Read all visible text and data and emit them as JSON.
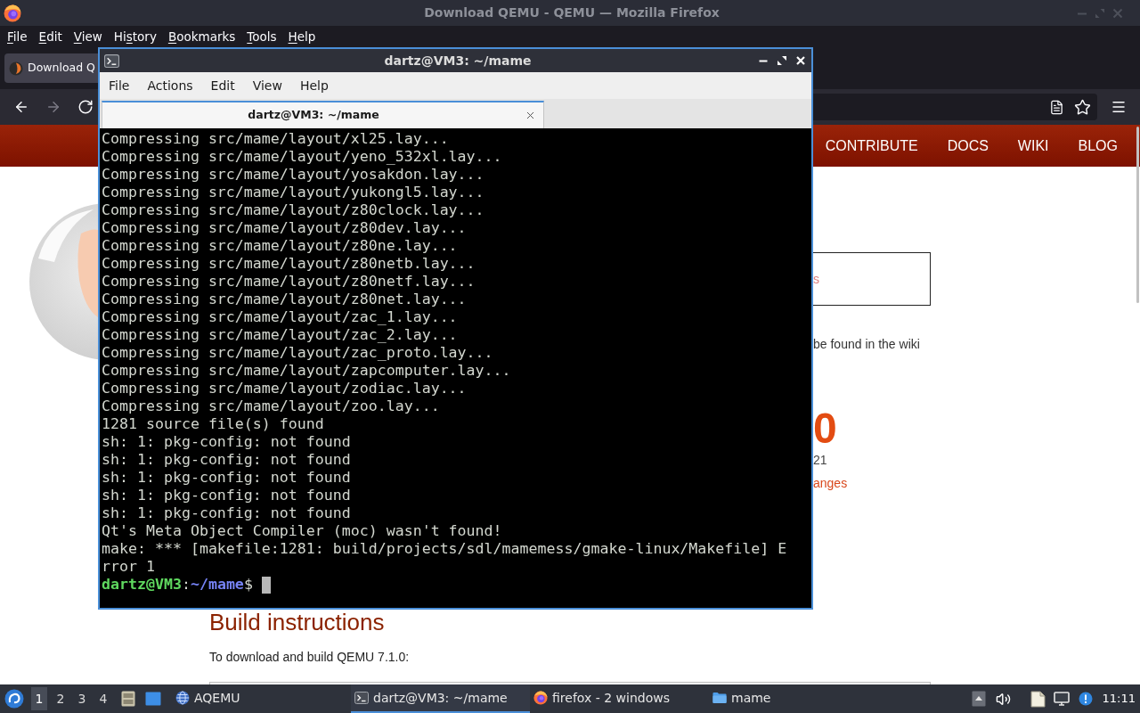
{
  "browser": {
    "title": "Download QEMU - QEMU — Mozilla Firefox",
    "menu": [
      {
        "key": "F",
        "post": "ile"
      },
      {
        "key": "E",
        "post": "dit"
      },
      {
        "key": "V",
        "post": "iew"
      },
      {
        "pre": "Hi",
        "key": "s",
        "post": "tory"
      },
      {
        "key": "B",
        "post": "ookmarks"
      },
      {
        "key": "T",
        "post": "ools"
      },
      {
        "key": "H",
        "post": "elp"
      }
    ],
    "tab": {
      "label": "Download Q",
      "selected": true
    },
    "nav_buttons": [
      {
        "kind": "back",
        "disabled": false
      },
      {
        "kind": "forward",
        "disabled": true
      },
      {
        "kind": "reload",
        "disabled": false
      }
    ],
    "page": {
      "nav_links": [
        "CONTRIBUTE",
        "DOCS",
        "WIKI",
        "BLOG"
      ],
      "notice_text": "s",
      "wiki_text": "be found in the wiki",
      "version": "0",
      "date": "21",
      "changes_link": "anges",
      "heading": "Build instructions",
      "intro": "To download and build QEMU 7.1.0:"
    }
  },
  "terminal": {
    "title": "dartz@VM3: ~/mame",
    "menu": [
      "File",
      "Actions",
      "Edit",
      "View",
      "Help"
    ],
    "tab": {
      "label": "dartz@VM3: ~/mame",
      "selected": true
    },
    "lines": [
      "Compressing src/mame/layout/xl25.lay...",
      "Compressing src/mame/layout/yeno_532xl.lay...",
      "Compressing src/mame/layout/yosakdon.lay...",
      "Compressing src/mame/layout/yukongl5.lay...",
      "Compressing src/mame/layout/z80clock.lay...",
      "Compressing src/mame/layout/z80dev.lay...",
      "Compressing src/mame/layout/z80ne.lay...",
      "Compressing src/mame/layout/z80netb.lay...",
      "Compressing src/mame/layout/z80netf.lay...",
      "Compressing src/mame/layout/z80net.lay...",
      "Compressing src/mame/layout/zac_1.lay...",
      "Compressing src/mame/layout/zac_2.lay...",
      "Compressing src/mame/layout/zac_proto.lay...",
      "Compressing src/mame/layout/zapcomputer.lay...",
      "Compressing src/mame/layout/zodiac.lay...",
      "Compressing src/mame/layout/zoo.lay...",
      "1281 source file(s) found",
      "sh: 1: pkg-config: not found",
      "sh: 1: pkg-config: not found",
      "sh: 1: pkg-config: not found",
      "sh: 1: pkg-config: not found",
      "sh: 1: pkg-config: not found",
      "Qt's Meta Object Compiler (moc) wasn't found!",
      "make: *** [makefile:1281: build/projects/sdl/mamemess/gmake-linux/Makefile] E",
      "rror 1"
    ],
    "prompt": {
      "user_host": "dartz@VM3",
      "separator": ":",
      "path": "~/mame",
      "symbol": "$"
    }
  },
  "taskbar": {
    "workspaces": [
      {
        "label": "1",
        "selected": true
      },
      {
        "label": "2",
        "selected": false
      },
      {
        "label": "3",
        "selected": false
      },
      {
        "label": "4",
        "selected": false
      }
    ],
    "tasks": [
      {
        "kind": "app",
        "label": "AQEMU",
        "selected": false
      },
      {
        "kind": "terminal",
        "label": "dartz@VM3: ~/mame",
        "selected": true
      },
      {
        "kind": "browser",
        "label": "firefox - 2 windows",
        "selected": false
      },
      {
        "kind": "folder",
        "label": "mame",
        "selected": false
      }
    ],
    "clock": "11:11"
  }
}
